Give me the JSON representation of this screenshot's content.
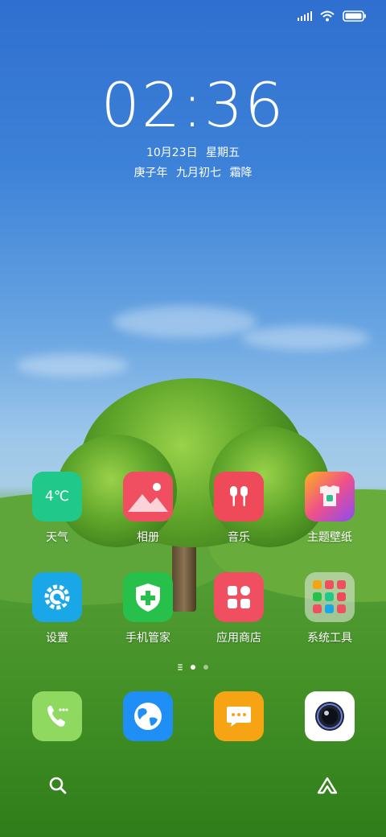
{
  "status": {
    "signal_bars": 4,
    "wifi": true,
    "battery_percent": 100
  },
  "clock": {
    "time": "02:36"
  },
  "date": {
    "gregorian": "10月23日",
    "weekday": "星期五"
  },
  "lunar": {
    "year": "庚子年",
    "day": "九月初七",
    "term": "霜降"
  },
  "weather_icon_text": "4℃",
  "apps": [
    {
      "label": "天气",
      "icon": "weather-icon",
      "color": "#20c98a"
    },
    {
      "label": "相册",
      "icon": "gallery-icon",
      "color": "#f04e61"
    },
    {
      "label": "音乐",
      "icon": "music-icon",
      "color": "#ee4a5a"
    },
    {
      "label": "主题壁纸",
      "icon": "themes-icon",
      "color": "#a855f7"
    },
    {
      "label": "设置",
      "icon": "settings-gear-icon",
      "color": "#1aa7e8"
    },
    {
      "label": "手机管家",
      "icon": "security-shield-icon",
      "color": "#27c04a"
    },
    {
      "label": "应用商店",
      "icon": "app-store-icon",
      "color": "#f04e61"
    },
    {
      "label": "系统工具",
      "icon": "tools-folder-icon",
      "color": "#c8d3c0"
    }
  ],
  "dock": [
    {
      "name": "phone",
      "icon": "phone-icon",
      "color": "#8fd960"
    },
    {
      "name": "browser",
      "icon": "browser-globe-icon",
      "color": "#1f8ff5"
    },
    {
      "name": "messages",
      "icon": "message-icon",
      "color": "#f7a414"
    },
    {
      "name": "camera",
      "icon": "camera-icon",
      "color": "#ffffff"
    }
  ],
  "page_indicator": {
    "pages": 2,
    "current": 1
  }
}
